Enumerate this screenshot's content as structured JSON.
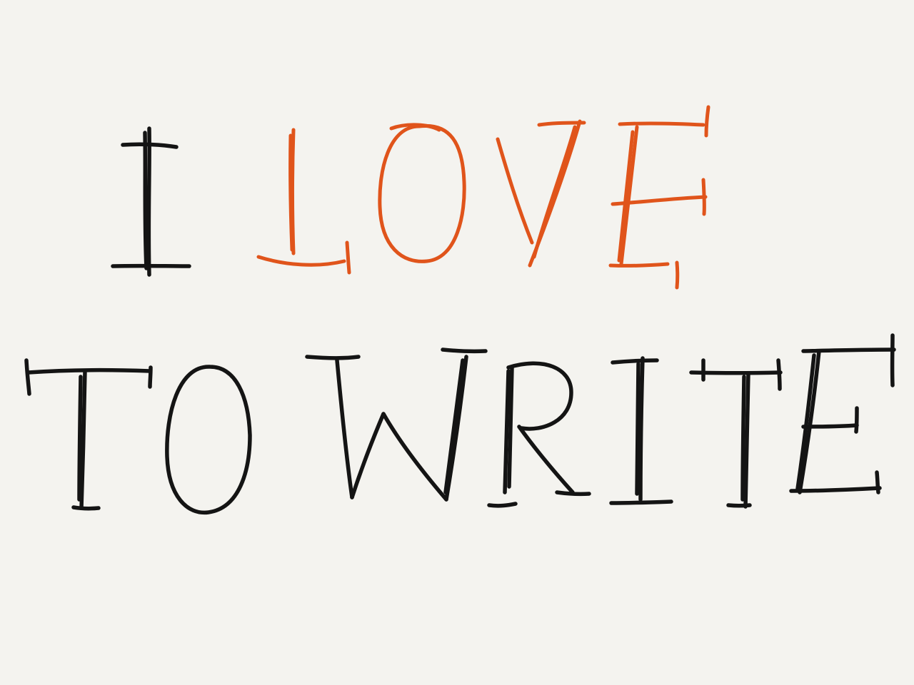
{
  "lettering": {
    "line1": [
      "I",
      "LOVE"
    ],
    "line2": [
      "TO",
      "WRITE"
    ]
  },
  "colors": {
    "paper": "#f4f3ef",
    "ink_black": "#141414",
    "ink_orange": "#e0541b"
  }
}
